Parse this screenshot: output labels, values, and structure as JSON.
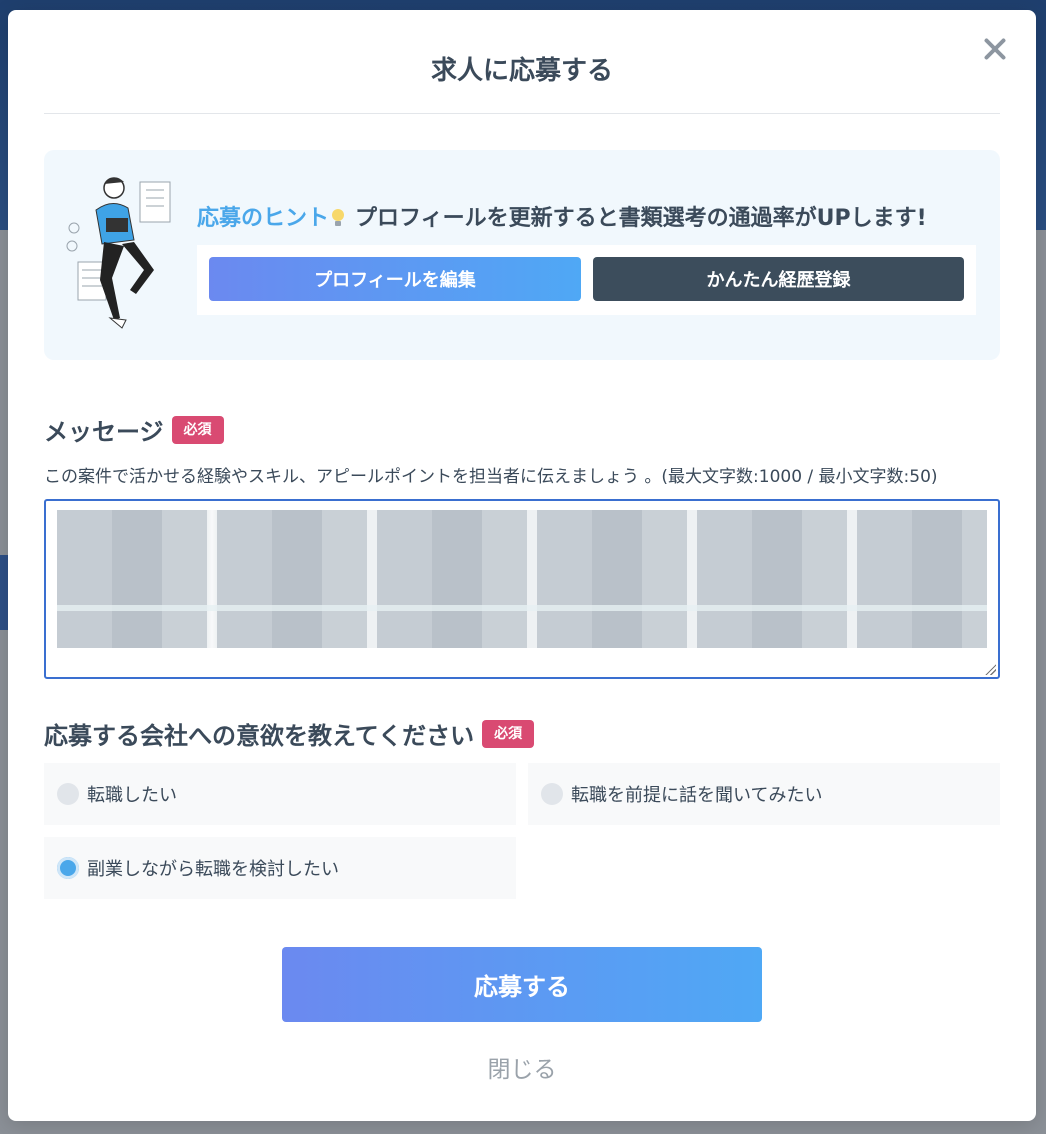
{
  "modal": {
    "title": "求人に応募する",
    "close_text": "閉じる"
  },
  "hint": {
    "label": "応募のヒント",
    "message": "プロフィールを更新すると書類選考の通過率がUPします!",
    "edit_profile_button": "プロフィールを編集",
    "resume_button": "かんたん経歴登録"
  },
  "message_section": {
    "heading": "メッセージ",
    "required_badge": "必須",
    "help_text": "この案件で活かせる経験やスキル、アピールポイントを担当者に伝えましょう 。(最大文字数:1000 / 最小文字数:50)",
    "value": ""
  },
  "motivation_section": {
    "heading": "応募する会社への意欲を教えてください",
    "required_badge": "必須",
    "options": [
      {
        "label": "転職したい",
        "selected": false
      },
      {
        "label": "転職を前提に話を聞いてみたい",
        "selected": false
      },
      {
        "label": "副業しながら転職を検討したい",
        "selected": true
      }
    ]
  },
  "apply_button": "応募する",
  "colors": {
    "accent_gradient_start": "#6b89f0",
    "accent_gradient_end": "#4fa8f5",
    "required_badge": "#d94a72",
    "dark_button": "#3c4d5c",
    "hint_label": "#4aa7ea"
  }
}
